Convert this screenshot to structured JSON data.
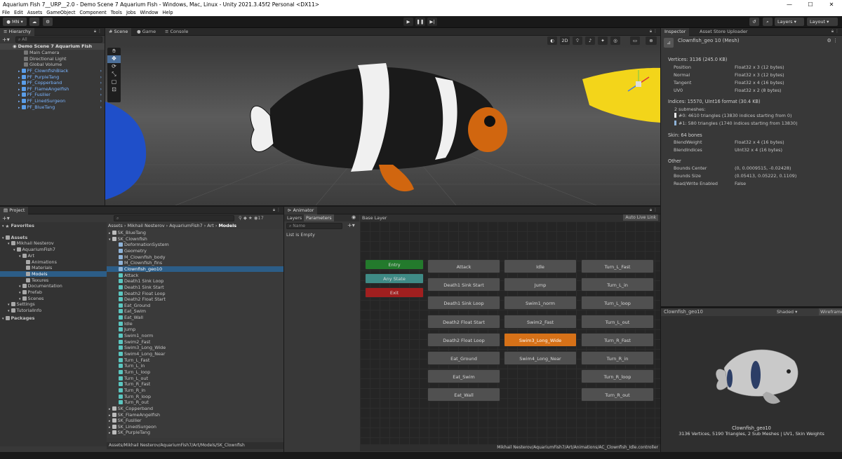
{
  "window": {
    "title": "Aquarium Fish 7__URP__2.0 - Demo Scene 7 Aquarium Fish - Windows, Mac, Linux - Unity 2021.3.45f2 Personal <DX11>"
  },
  "menu": [
    "File",
    "Edit",
    "Assets",
    "GameObject",
    "Component",
    "Tools",
    "Jobs",
    "Window",
    "Help"
  ],
  "toolbar": {
    "account": "MN",
    "layers": "Layers",
    "layout": "Layout"
  },
  "hierarchy": {
    "tab": "Hierarchy",
    "search_placeholder": "All",
    "scene": "Demo Scene 7 Aquarium Fish",
    "children": [
      "Main Camera",
      "Directional Light",
      "Global Volume"
    ],
    "prefabs": [
      "PF_ClownfishBlack",
      "PF_PurpleTang",
      "PF_Copperband",
      "PF_FlameAngelfish",
      "PF_Fusilier",
      "PF_LinedSurgeon",
      "PF_BlueTang"
    ]
  },
  "scene": {
    "tabs": [
      "Scene",
      "Game",
      "Console"
    ],
    "mode2d": "2D"
  },
  "project": {
    "tab": "Project",
    "count": "17",
    "tree": [
      {
        "t": "Favorites",
        "d": 0,
        "b": true
      },
      {
        "t": "Assets",
        "d": 0,
        "b": true
      },
      {
        "t": "Mikhail Nesterov",
        "d": 1
      },
      {
        "t": "AquariumFish7",
        "d": 2
      },
      {
        "t": "Art",
        "d": 3
      },
      {
        "t": "Animations",
        "d": 4
      },
      {
        "t": "Materials",
        "d": 4
      },
      {
        "t": "Models",
        "d": 4,
        "sel": true
      },
      {
        "t": "Texures",
        "d": 4
      },
      {
        "t": "Documentation",
        "d": 3
      },
      {
        "t": "Prefab",
        "d": 3
      },
      {
        "t": "Scenes",
        "d": 3
      },
      {
        "t": "Settings",
        "d": 1
      },
      {
        "t": "TutorialInfo",
        "d": 1
      },
      {
        "t": "Packages",
        "d": 0,
        "b": true
      }
    ],
    "breadcrumb": [
      "Assets",
      "Mikhail Nesterov",
      "AquariumFish7",
      "Art",
      "Models"
    ],
    "files": [
      {
        "t": "SK_BlueTang",
        "d": 0
      },
      {
        "t": "SK_Clownfish",
        "d": 0
      },
      {
        "t": "DeformationSystem",
        "d": 1
      },
      {
        "t": "Geometry",
        "d": 1
      },
      {
        "t": "M_Clownfish_body",
        "d": 1
      },
      {
        "t": "M_Clownfish_fins",
        "d": 1
      },
      {
        "t": "Clownfish_geo10",
        "d": 1,
        "sel": true
      },
      {
        "t": "Attack",
        "d": 1
      },
      {
        "t": "Death1 Sink Loop",
        "d": 1
      },
      {
        "t": "Death1 Sink Start",
        "d": 1
      },
      {
        "t": "Death2 Float Loop",
        "d": 1
      },
      {
        "t": "Death2 Float Start",
        "d": 1
      },
      {
        "t": "Eat_Ground",
        "d": 1
      },
      {
        "t": "Eat_Swim",
        "d": 1
      },
      {
        "t": "Eat_Wall",
        "d": 1
      },
      {
        "t": "Idle",
        "d": 1
      },
      {
        "t": "Jump",
        "d": 1
      },
      {
        "t": "Swim1_norm",
        "d": 1
      },
      {
        "t": "Swim2_Fast",
        "d": 1
      },
      {
        "t": "Swim3_Long_Wide",
        "d": 1
      },
      {
        "t": "Swim4_Long_Near",
        "d": 1
      },
      {
        "t": "Turn_L_Fast",
        "d": 1
      },
      {
        "t": "Turn_L_in",
        "d": 1
      },
      {
        "t": "Turn_L_loop",
        "d": 1
      },
      {
        "t": "Turn_L_out",
        "d": 1
      },
      {
        "t": "Turn_R_Fast",
        "d": 1
      },
      {
        "t": "Turn_R_in",
        "d": 1
      },
      {
        "t": "Turn_R_loop",
        "d": 1
      },
      {
        "t": "Turn_R_out",
        "d": 1
      },
      {
        "t": "SK_Copperband",
        "d": 0
      },
      {
        "t": "SK_FlameAngelfish",
        "d": 0
      },
      {
        "t": "SK_Fusilier",
        "d": 0
      },
      {
        "t": "SK_LinedSurgeon",
        "d": 0
      },
      {
        "t": "SK_PurpleTang",
        "d": 0
      }
    ],
    "footer": "Assets/Mikhail Nesterov/AquariumFish7/Art/Models/SK_Clownfish"
  },
  "animator": {
    "tab": "Animator",
    "layers": "Layers",
    "parameters": "Parameters",
    "base_layer": "Base Layer",
    "auto_live_link": "Auto Live Link",
    "name_placeholder": "Name",
    "list_empty": "List is Empty",
    "special": [
      "Entry",
      "Any State",
      "Exit"
    ],
    "col1": [
      "Attack",
      "Death1 Sink Start",
      "Death1 Sink Loop",
      "Death2 Float Start",
      "Death2 Float Loop",
      "Eat_Ground",
      "Eat_Swim",
      "Eat_Wall"
    ],
    "col2": [
      "Idle",
      "Jump",
      "Swim1_norm",
      "Swim2_Fast",
      "Swim3_Long_Wide",
      "Swim4_Long_Near"
    ],
    "col3": [
      "Turn_L_Fast",
      "Turn_L_in",
      "Turn_L_loop",
      "Turn_L_out",
      "Turn_R_Fast",
      "Turn_R_in",
      "Turn_R_loop",
      "Turn_R_out"
    ],
    "default_state": "Swim3_Long_Wide",
    "footer": "Mikhail Nesterov/AquariumFish7/Art/Animations/AC_Clownfish_Idle.controller"
  },
  "inspector": {
    "tabs": [
      "Inspector",
      "Asset Store Uploader"
    ],
    "object": "Clownfish_geo 10 (Mesh)",
    "vertices": "Vertices: 3136 (245.0 KB)",
    "attrs": [
      [
        "Position",
        "Float32 x 3 (12 bytes)"
      ],
      [
        "Normal",
        "Float32 x 3 (12 bytes)"
      ],
      [
        "Tangent",
        "Float32 x 4 (16 bytes)"
      ],
      [
        "UV0",
        "Float32 x 2 (8 bytes)"
      ]
    ],
    "indices": "Indices: 15570, UInt16 format (30.4 KB)",
    "submeshes": "2 submeshes:",
    "sub": [
      "#0: 4610 triangles (13830 indices starting from 0)",
      "#1: 580 triangles (1740 indices starting from 13830)"
    ],
    "skin": "Skin: 64 bones",
    "skin_attrs": [
      [
        "BlendWeight",
        "Float32 x 4 (16 bytes)"
      ],
      [
        "BlendIndices",
        "UInt32 x 4 (16 bytes)"
      ]
    ],
    "other": "Other",
    "other_attrs": [
      [
        "Bounds Center",
        "(0, 0.0009515, -0.02428)"
      ],
      [
        "Bounds Size",
        "(0.05413, 0.05222, 0.1109)"
      ],
      [
        "Read/Write Enabled",
        "False"
      ]
    ],
    "preview_title": "Clownfish_geo10",
    "shaded": "Shaded",
    "wireframe": "Wireframe",
    "preview_name": "Clownfish_geo10",
    "preview_stats": "3136 Vertices, 5190 Triangles, 2 Sub Meshes | UV1, Skin Weights"
  }
}
